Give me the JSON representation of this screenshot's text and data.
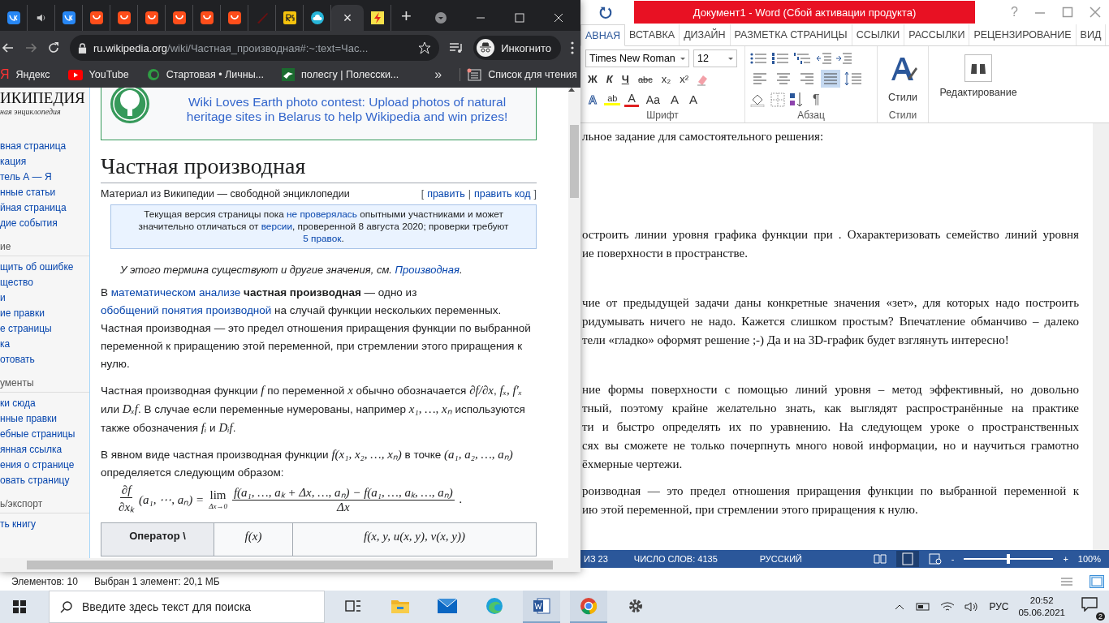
{
  "word": {
    "title": "Документ1 -  Word (Сбой активации продукта)",
    "help": "?",
    "tabs": [
      {
        "label": "АВНАЯ",
        "selected": true
      },
      {
        "label": "ВСТАВКА",
        "selected": false
      },
      {
        "label": "ДИЗАЙН",
        "selected": false
      },
      {
        "label": "РАЗМЕТКА СТРАНИЦЫ",
        "selected": false
      },
      {
        "label": "ССЫЛКИ",
        "selected": false
      },
      {
        "label": "РАССЫЛКИ",
        "selected": false
      },
      {
        "label": "РЕЦЕНЗИРОВАНИЕ",
        "selected": false
      },
      {
        "label": "ВИД",
        "selected": false
      }
    ],
    "font_name": "Times New Roman",
    "font_size": "12",
    "format_buttons": [
      {
        "label": "Ж",
        "kind": "bold"
      },
      {
        "label": "К",
        "kind": "italic"
      },
      {
        "label": "Ч",
        "kind": "underline"
      },
      {
        "label": "abc",
        "kind": "strike"
      },
      {
        "label": "x₂",
        "kind": "plain"
      },
      {
        "label": "x²",
        "kind": "plain"
      }
    ],
    "font_buttons": [
      {
        "label": "A",
        "kind": "effect"
      },
      {
        "label": "ab",
        "kind": "highlight"
      },
      {
        "label": "A",
        "kind": "color"
      },
      {
        "label": "Аа",
        "kind": "plain"
      },
      {
        "label": "A",
        "kind": "plain"
      },
      {
        "label": "A",
        "kind": "plain"
      }
    ],
    "align_buttons": [
      {
        "selected": false
      },
      {
        "selected": false
      },
      {
        "selected": false
      },
      {
        "selected": true
      }
    ],
    "pilcrow": "¶",
    "groups": [
      "Шрифт",
      "Абзац",
      "Стили"
    ],
    "styles_button": "Стили",
    "editing_button": "Редактирование",
    "document": [
      {
        "lines": [
          "льное задание для самостоятельного решения:"
        ]
      },
      {
        "lines": [
          "остроить линии уровня графика функции  при . Охарактеризовать семейство  линий уровня",
          "ие поверхности в пространстве."
        ]
      },
      {
        "lines": [
          "чие от предыдущей задачи даны конкретные значения «зет», для которых надо построить",
          "ридумывать ничего не надо. Кажется слишком простым? Впечатление обманчиво – далеко",
          "тели «гладко» оформят решение ;-) Да и на 3D-график будет взглянуть интересно!"
        ]
      },
      {
        "lines": [
          "ние формы поверхности с помощью линий уровня – метод эффективный, но довольно",
          "тный, поэтому крайне желательно знать, как выглядят распространённые на практике",
          "ти и быстро определять их по уравнению. На следующем уроке о пространственных",
          "сях вы сможете не только почерпнуть много новой информации, но и научиться грамотно",
          "ёхмерные чертежи."
        ]
      },
      {
        "lines": [
          "роизводная — это предел отношения приращения функции по выбранной переменной к",
          "ию этой переменной, при стремлении этого приращения к нулю."
        ]
      }
    ],
    "status": {
      "page": "ИЗ 23",
      "words": "ЧИСЛО СЛОВ: 4135",
      "language": "РУССКИЙ",
      "zoom": "100%",
      "zoom_level": {
        "level": 0.5
      },
      "minus": "-",
      "plus": "+"
    }
  },
  "browser": {
    "tabs": [
      {
        "kind": "vk",
        "selected": false
      },
      {
        "kind": "audio",
        "selected": false
      },
      {
        "kind": "vk",
        "selected": false
      },
      {
        "kind": "shop",
        "selected": false
      },
      {
        "kind": "shop",
        "selected": false
      },
      {
        "kind": "shop",
        "selected": false
      },
      {
        "kind": "shop",
        "selected": false
      },
      {
        "kind": "shop",
        "selected": false
      },
      {
        "kind": "shop",
        "selected": false
      },
      {
        "kind": "brush",
        "selected": false
      },
      {
        "kind": "rs",
        "selected": false
      },
      {
        "kind": "cloud",
        "selected": false
      },
      {
        "kind": "blank",
        "selected": true
      },
      {
        "kind": "flash",
        "selected": false
      }
    ],
    "tab_close": "×",
    "new_tab": "+",
    "url_host": "ru.wikipedia.org",
    "url_path": "/wiki/Частная_производная#:~:text=Час...",
    "incognito": "Инкогнито",
    "bookmarks": [
      {
        "label": "Яндекс",
        "kind": "yandex"
      },
      {
        "label": "YouTube",
        "kind": "youtube"
      },
      {
        "label": "Стартовая • Личны...",
        "kind": "c"
      },
      {
        "label": "полесгу | Полесски...",
        "kind": "polesgu"
      }
    ],
    "yandex_glyph": "Я",
    "more": "»",
    "reading_list": "Список для чтения",
    "wiki": {
      "logo": "ИКИПЕДИЯ",
      "logo_sub": "ная энциклопедия",
      "sidebar": [
        {
          "items": [
            "вная страница",
            "кация",
            "тель А — Я",
            "нные статьи",
            "йная страница",
            "дие события"
          ]
        },
        {
          "heading": "ие",
          "items": [
            "щить об ошибке",
            "щество",
            "и",
            "ие правки",
            "е страницы",
            "ка",
            "отовать"
          ]
        },
        {
          "heading": "ументы",
          "items": [
            "ки сюда",
            "нные правки",
            "ебные страницы",
            "янная ссылка",
            "ения о странице",
            "овать страницу"
          ]
        },
        {
          "heading": "ь/экспорт",
          "items": [
            "ть книгу"
          ]
        }
      ],
      "banner": [
        "Wiki Loves Earth photo contest: Upload photos of natural",
        "heritage sites in Belarus to help Wikipedia and win prizes!"
      ],
      "title": "Частная производная",
      "subtitle": "Материал из Википедии — свободной энциклопедии",
      "edit_links": [
        "править",
        "править код"
      ],
      "edit_marks": [
        "[",
        "|",
        "]"
      ],
      "notice": [
        {
          "t": "Текущая версия страницы пока ",
          "kind": "text"
        },
        {
          "t": "не проверялась",
          "kind": "link"
        },
        {
          "t": " опытными участниками и может значительно отличаться от ",
          "kind": "text"
        },
        {
          "t": "версии",
          "kind": "link"
        },
        {
          "t": ", проверенной 8 августа 2020; проверки требуют ",
          "kind": "text"
        },
        {
          "t": "5 правок",
          "kind": "link"
        },
        {
          "t": ".",
          "kind": "text"
        }
      ],
      "hatnote": [
        {
          "t": "У этого термина существуют и другие значения, см. ",
          "kind": "text"
        },
        {
          "t": "Производная",
          "kind": "link"
        },
        {
          "t": ".",
          "kind": "text"
        }
      ],
      "paragraphs": [
        [
          {
            "t": "В ",
            "kind": "text"
          },
          {
            "t": "математическом анализе",
            "kind": "link"
          },
          {
            "t": " частная производная",
            "kind": "bold"
          },
          {
            "t": " — одно из ",
            "kind": "text"
          },
          {
            "t": "обобщений понятия производной",
            "kind": "link"
          },
          {
            "t": " на случай функции нескольких переменных. Частная производная — это предел отношения приращения функции по выбранной переменной к приращению этой переменной, при стремлении этого приращения к нулю.",
            "kind": "text"
          }
        ],
        [
          {
            "t": "Частная производная функции ",
            "kind": "text"
          },
          {
            "t": "f",
            "kind": "math"
          },
          {
            "t": " по переменной ",
            "kind": "text"
          },
          {
            "t": "x",
            "kind": "math"
          },
          {
            "t": " обычно обозначается ",
            "kind": "text"
          },
          {
            "t": "∂f/∂x",
            "kind": "math"
          },
          {
            "t": ", ",
            "kind": "text"
          },
          {
            "t": "fₓ, f′ₓ",
            "kind": "math"
          },
          {
            "t": " или ",
            "kind": "text"
          },
          {
            "t": "Dₓf",
            "kind": "math"
          },
          {
            "t": ". В случае если переменные нумерованы, например ",
            "kind": "text"
          },
          {
            "t": "x₁, …, xₙ",
            "kind": "math"
          },
          {
            "t": " используются также обозначения ",
            "kind": "text"
          },
          {
            "t": "fᵢ",
            "kind": "math"
          },
          {
            "t": " и ",
            "kind": "text"
          },
          {
            "t": "Dᵢf",
            "kind": "math"
          },
          {
            "t": ".",
            "kind": "text"
          }
        ],
        [
          {
            "t": "В явном виде частная производная функции ",
            "kind": "text"
          },
          {
            "t": "f(x₁, x₂, …, xₙ)",
            "kind": "math"
          },
          {
            "t": " в точке ",
            "kind": "text"
          },
          {
            "t": "(a₁, a₂, …, aₙ)",
            "kind": "math"
          },
          {
            "t": " определяется следующим образом:",
            "kind": "text"
          }
        ]
      ],
      "formula": {
        "num": "∂f",
        "den": "∂xₖ",
        "args": "(a₁, ⋯, aₙ) =",
        "lim": "lim",
        "lim_sub": "Δx→0",
        "frac_num": "f(a₁, …, aₖ + Δx, …, aₙ) − f(a₁, …, aₖ, …, aₙ)",
        "frac_den": "Δx",
        "end": "."
      },
      "table_headers": [
        "Оператор \\",
        "f(x)",
        "f(x, y, u(x, y), v(x, y))"
      ]
    }
  },
  "explorer_status": [
    "Элементов: 10",
    "Выбран 1 элемент: 20,1 МБ"
  ],
  "taskbar": {
    "search_placeholder": "Введите здесь текст для поиска",
    "language": "РУС",
    "time": "20:52",
    "date": "05.06.2021",
    "notifications": "2",
    "apps": [
      {
        "kind": "taskview",
        "selected": false
      },
      {
        "kind": "folder",
        "selected": false
      },
      {
        "kind": "mail",
        "selected": false
      },
      {
        "kind": "edge",
        "selected": false
      },
      {
        "kind": "word",
        "selected": true
      },
      {
        "kind": "chrome",
        "selected": true
      },
      {
        "kind": "gear",
        "selected": false
      }
    ]
  }
}
